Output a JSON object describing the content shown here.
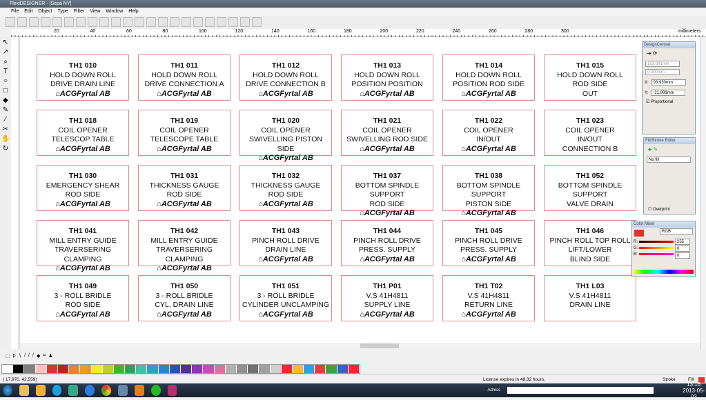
{
  "window": {
    "title": "FlexiDESIGNER - [Sepa NY]"
  },
  "menu": [
    "File",
    "Edit",
    "Object",
    "Type",
    "Filter",
    "View",
    "Window",
    "Help"
  ],
  "ruler": {
    "ticks": [
      "20",
      "40",
      "60",
      "80",
      "100",
      "120",
      "140",
      "160",
      "180",
      "200",
      "220",
      "240",
      "260",
      "280",
      "300"
    ],
    "unit": "millimeters"
  },
  "labels": [
    [
      "TH1 010",
      "HOLD DOWN ROLL",
      "DRIVE DRAIN LINE",
      "logo"
    ],
    [
      "TH1 011",
      "HOLD DOWN ROLL",
      "DRIVE CONNECTION A",
      "logo"
    ],
    [
      "TH1 012",
      "HOLD DOWN ROLL",
      "DRIVE CONNECTION B",
      "logo"
    ],
    [
      "TH1 013",
      "HOLD DOWN ROLL",
      "POSITION POSITION",
      "logo"
    ],
    [
      "TH1 014",
      "HOLD DOWN ROLL",
      "POSITION ROD SIDE",
      "logo"
    ],
    [
      "TH1 015",
      "HOLD DOWN ROLL",
      "ROD SIDE",
      "OUT"
    ],
    [
      "TH1 018",
      "COIL OPENER",
      "TELESCOP TABLE",
      "logo"
    ],
    [
      "TH1 019",
      "COIL OPENER",
      "TELESCOPE TABLE",
      "logo"
    ],
    [
      "TH1 020",
      "COIL OPENER",
      "SWIVELLING PISTON SIDE",
      "logo"
    ],
    [
      "TH1 021",
      "COIL OPENER",
      "SWIVELLING ROD SIDE",
      "logo"
    ],
    [
      "TH1 022",
      "COIL OPENER",
      "IN/OUT",
      "logo"
    ],
    [
      "TH1 023",
      "COIL OPENER",
      "IN/OUT",
      "CONNECTION B"
    ],
    [
      "TH1 030",
      "EMERGENCY SHEAR",
      "ROD SIDE",
      "logo"
    ],
    [
      "TH1 031",
      "THICKNESS GAUGE",
      "ROD SIDE",
      "logo"
    ],
    [
      "TH1 032",
      "THICKNESS GAUGE",
      "ROD SIDE",
      "logo"
    ],
    [
      "TH1 037",
      "BOTTOM SPINDLE SUPPORT",
      "ROD SIDE",
      "logo"
    ],
    [
      "TH1 038",
      "BOTTOM SPINDLE SUPPORT",
      "PISTON SIDE",
      "logo"
    ],
    [
      "TH1 052",
      "BOTTOM SPINDLE SUPPORT",
      "VALVE DRAIN",
      ""
    ],
    [
      "TH1 041",
      "MILL ENTRY GUIDE",
      "TRAVERSERING CLAMPING",
      "logo"
    ],
    [
      "TH1 042",
      "MILL ENTRY GUIDE",
      "TRAVERSERING CLAMPING",
      "logo"
    ],
    [
      "TH1 043",
      "PINCH ROLL DRIVE",
      "DRAIN LINE",
      "logo"
    ],
    [
      "TH1 044",
      "PINCH ROLL DRIVE",
      "PRESS. SUPPLY",
      "logo"
    ],
    [
      "TH1 045",
      "PINCH ROLL DRIVE",
      "PRESS. SUPPLY",
      "logo"
    ],
    [
      "TH1 046",
      "PINCH ROLL TOP ROLL",
      "LIFT/LOWER",
      "BLIND SIDE"
    ],
    [
      "TH1 049",
      "3 - ROLL BRIDLE",
      "ROD SIDE",
      "logo"
    ],
    [
      "TH1 050",
      "3 - ROLL BRIDLE",
      "CYL, DRAIN LINE",
      "logo"
    ],
    [
      "TH1 051",
      "3 - ROLL BRIDLE",
      "CYLINDER UNCLAMPING",
      "logo"
    ],
    [
      "TH1 P01",
      "V.S 41H4811",
      "SUPPLY LINE",
      "logo"
    ],
    [
      "TH1 T02",
      "V.S 41H4811",
      "RETURN LINE",
      "logo"
    ],
    [
      "TH1 L03",
      "V.S 41H4811",
      "DRAIN LINE",
      ""
    ]
  ],
  "logo_text": "ACGFyrtal AB",
  "design_central": {
    "title": "DesignCentral",
    "width": "183.881mm",
    "height": "0.000mm",
    "x_label": "X:",
    "x": "93.930mm",
    "y_label": "Y:",
    "y": "-21.899mm",
    "proportional": "Proportional"
  },
  "fill_stroke": {
    "title": "Fill/Stroke Editor",
    "fill": "No fill",
    "overprint": "Overprint"
  },
  "color_mixer": {
    "title": "Color Mixer",
    "model": "RGB",
    "r": "255",
    "g": "0",
    "b": "0",
    "r_label": "R:",
    "g_label": "G:",
    "b_label": "B:",
    "color": "#e8302a"
  },
  "status": {
    "coords": "( 17,970,   42,559)",
    "license": "License expires in 48,32 hours.",
    "stroke": "Stroke",
    "fill": "Fill"
  },
  "taskbar": {
    "address_label": "Adress",
    "time": "13:16",
    "date": "2013-05-03"
  },
  "palette": [
    "#ffffff",
    "#000000",
    "#808080",
    "#ffc0c0",
    "#e03030",
    "#c02020",
    "#f08030",
    "#e0a020",
    "#f0f020",
    "#c0d020",
    "#40b040",
    "#30a060",
    "#40c0a0",
    "#30a0c0",
    "#3080d0",
    "#3050b0",
    "#503090",
    "#8040a0",
    "#c050b0",
    "#e070a0",
    "#b0b0b0",
    "#909090",
    "#707070",
    "#a0a0a0",
    "#d0d0d0",
    "#e03030",
    "#f0c020",
    "#30a0e0",
    "#e04040",
    "#40a040",
    "#4060c0",
    "#e03030"
  ]
}
